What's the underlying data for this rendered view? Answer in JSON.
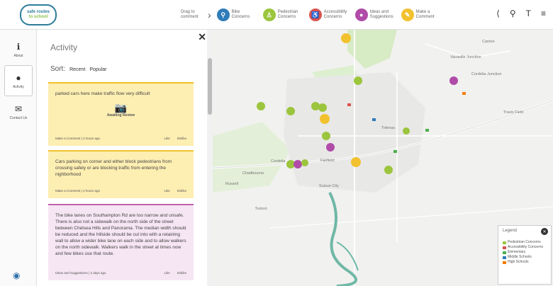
{
  "app": {
    "logo_line1": "safe routes",
    "logo_line2": "to school"
  },
  "topbar": {
    "drag_hint": "Drag to comment",
    "categories": [
      {
        "label": "Bike Concerns",
        "icon": "bike-icon",
        "color": "#2e7cb8"
      },
      {
        "label": "Pedestrian Concerns",
        "icon": "pedestrian-icon",
        "color": "#9bc53d"
      },
      {
        "label": "Accessibility Concerns",
        "icon": "accessibility-icon",
        "color": "#d9534f"
      },
      {
        "label": "Ideas and Suggestions",
        "icon": "pin-icon",
        "color": "#b04ca8"
      },
      {
        "label": "Make a Comment",
        "icon": "comment-icon",
        "color": "#f2c12e"
      }
    ]
  },
  "nav": {
    "items": [
      {
        "label": "About",
        "icon": "info-icon"
      },
      {
        "label": "Activity",
        "icon": "chat-icon"
      },
      {
        "label": "Contact Us",
        "icon": "mail-icon"
      }
    ]
  },
  "panel": {
    "title": "Activity",
    "sort_label": "Sort:",
    "sort_options": [
      "Recent",
      "Popular"
    ],
    "cards": [
      {
        "text": "parked cars here make traffic flow very difficult",
        "status": "Awaiting Review",
        "meta": "Make a Comment | 4 hours ago",
        "like": "Like",
        "dislike": "Dislike"
      },
      {
        "text": "Cars parking on corner and either block pedestrians from crossing safely or are blocking traffic from entering the nighborhood",
        "meta": "Make a Comment | 4 hours ago",
        "like": "Like",
        "dislike": "Dislike"
      },
      {
        "text": "The bike lanes on Southampton Rd are too narrow and unsafe. There is also not a sidewalk on the north side of the street between Chelsea Hills and Panorama. The median width should be reduced and the hillside should be cut into with a retaining wall to allow a wider bike lane on each side and to allow walkers on the north sidewalk. Walkers walk in the street at times now and few bikes use that route.",
        "meta": "Ideas and Suggestions | 2 days ago",
        "like": "Like",
        "dislike": "Dislike"
      }
    ]
  },
  "map": {
    "labels": [
      "Vacaville Junction",
      "Cordelia Junction",
      "Travis Field",
      "Fairfield",
      "Suisun City",
      "Cordelia",
      "Chadbourne",
      "Tolenas",
      "Russell",
      "Suisun",
      "Canton"
    ]
  },
  "legend": {
    "title": "Legend",
    "items": [
      {
        "label": "Pedestrian Concerns",
        "color": "#9bc53d"
      },
      {
        "label": "Accessibility Concerns",
        "color": "#d9534f"
      },
      {
        "label": "Elementary",
        "color": "#4caf50"
      },
      {
        "label": "Middle Schools",
        "color": "#2e7cb8"
      },
      {
        "label": "High Schools",
        "color": "#f57c00"
      }
    ]
  }
}
